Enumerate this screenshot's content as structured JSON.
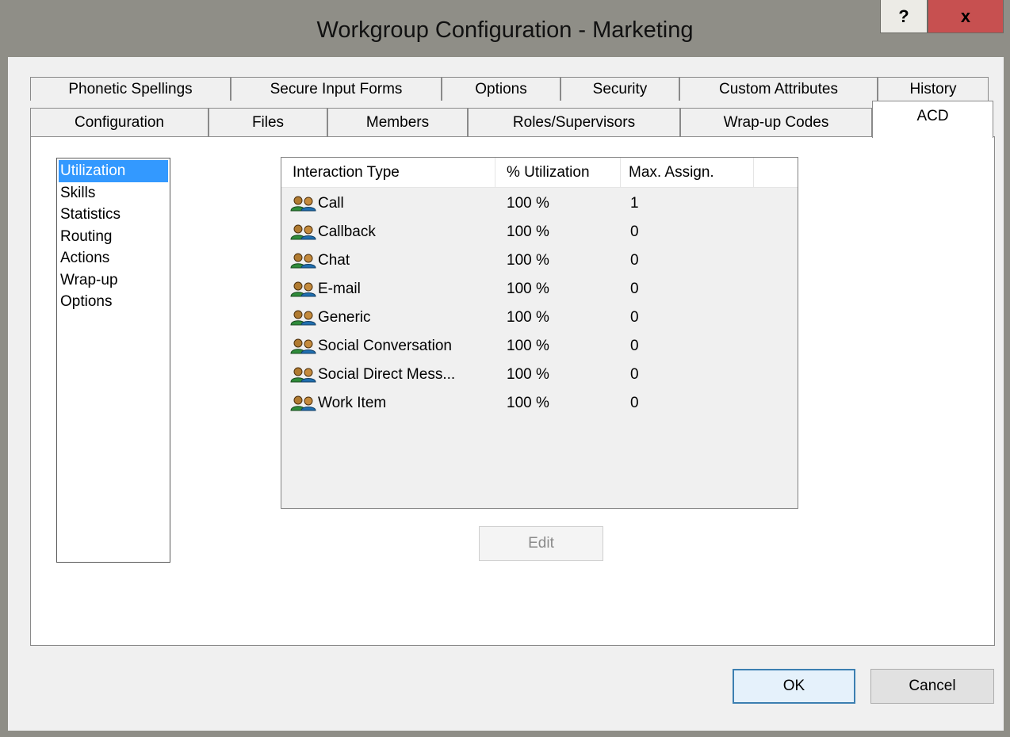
{
  "window": {
    "title": "Workgroup Configuration - Marketing",
    "help_label": "?",
    "close_label": "x"
  },
  "tabs": {
    "row1": [
      "Phonetic Spellings",
      "Secure Input Forms",
      "Options",
      "Security",
      "Custom Attributes",
      "History"
    ],
    "row2": [
      "Configuration",
      "Files",
      "Members",
      "Roles/Supervisors",
      "Wrap-up Codes",
      "ACD"
    ],
    "selected": "ACD"
  },
  "nav": {
    "items": [
      "Utilization",
      "Skills",
      "Statistics",
      "Routing",
      "Actions",
      "Wrap-up",
      "Options"
    ],
    "selected": "Utilization"
  },
  "table": {
    "columns": [
      "Interaction Type",
      "% Utilization",
      "Max. Assign."
    ],
    "rows": [
      {
        "type": "Call",
        "utilization": "100 %",
        "max": "1"
      },
      {
        "type": "Callback",
        "utilization": "100 %",
        "max": "0"
      },
      {
        "type": "Chat",
        "utilization": "100 %",
        "max": "0"
      },
      {
        "type": "E-mail",
        "utilization": "100 %",
        "max": "0"
      },
      {
        "type": "Generic",
        "utilization": "100 %",
        "max": "0"
      },
      {
        "type": "Social Conversation",
        "utilization": "100 %",
        "max": "0"
      },
      {
        "type": "Social Direct Mess...",
        "utilization": "100 %",
        "max": "0"
      },
      {
        "type": "Work Item",
        "utilization": "100 %",
        "max": "0"
      }
    ],
    "row_icon": "users-icon"
  },
  "buttons": {
    "edit": "Edit",
    "ok": "OK",
    "cancel": "Cancel"
  }
}
